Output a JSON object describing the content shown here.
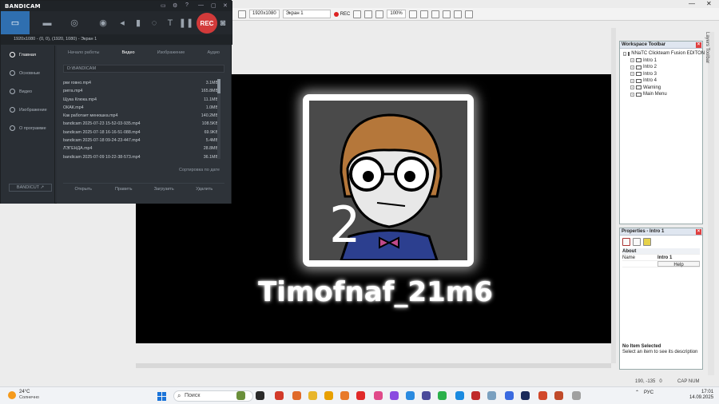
{
  "editor": {
    "toolbar": {
      "resolution": "1920x1080",
      "screen": "Экран 1",
      "rec": "REC",
      "zoom": "100%"
    },
    "frame": {
      "game_title": "Timofnaf_21m6",
      "portrait_number": "2"
    },
    "workspace": {
      "title": "Workspace Toolbar",
      "root": "NNaTC Clickteam Fusion EDITON",
      "items": [
        "Intro 1",
        "Intro 2",
        "Intro 3",
        "Intro 4",
        "Warning",
        "Main Menu"
      ]
    },
    "properties": {
      "title": "Properties - Intro 1",
      "section": "About",
      "name_label": "Name",
      "name_value": "Intro 1",
      "help": "Help",
      "no_item_title": "No Item Selected",
      "no_item_desc": "Select an item to see its description"
    },
    "vertical_tab": "Layers Toolbar",
    "status": {
      "coords": "190, -135",
      "zero": "0",
      "caps": "CAP NUM"
    }
  },
  "bandicam": {
    "logo": "BANDICAM",
    "rec": "REC",
    "target": "1920x1080 - (0, 0), (1920, 1080) - Экран 1",
    "sidebar": [
      "Главная",
      "Основные",
      "Видео",
      "Изображение",
      "О программе"
    ],
    "tabs": [
      "Начало работы",
      "Видео",
      "Изображение",
      "Аудио"
    ],
    "path": "D:\\BANDICAM",
    "files": [
      {
        "name": "рки говно.mp4",
        "size": "3.1MB"
      },
      {
        "name": "ригга.mp4",
        "size": "165.8MB"
      },
      {
        "name": "Щука Клюка.mp4",
        "size": "11.1MB"
      },
      {
        "name": "ОКАК.mp4",
        "size": "1.0MB"
      },
      {
        "name": "Как работает менюшка.mp4",
        "size": "140.2MB"
      },
      {
        "name": "bandicam 2025-07-23 15-52-03-935.mp4",
        "size": "108.5KB"
      },
      {
        "name": "bandicam 2025-07-18 16-16-51-088.mp4",
        "size": "69.9KB"
      },
      {
        "name": "bandicam 2025-07-18 09-24-23-447.mp4",
        "size": "5.4MB"
      },
      {
        "name": "ЛЭГЕНДА.mp4",
        "size": "28.8MB"
      },
      {
        "name": "bandicam 2025-07-09 10-22-38-573.mp4",
        "size": "36.1MB"
      }
    ],
    "sort": "Сортировка по дате",
    "actions": [
      "Открыть",
      "Править",
      "Загрузить",
      "Удалить"
    ],
    "bandicut": "BANDICUT ↗"
  },
  "taskbar": {
    "weather_temp": "24°C",
    "weather_desc": "Солнечно",
    "search": "Поиск",
    "lang": "РУС",
    "time": "17:01",
    "date": "14.09.2025"
  },
  "colors": {
    "bandicam_bg": "#2b3036",
    "rec": "#d23a3a",
    "accent": "#2f6fb0"
  }
}
